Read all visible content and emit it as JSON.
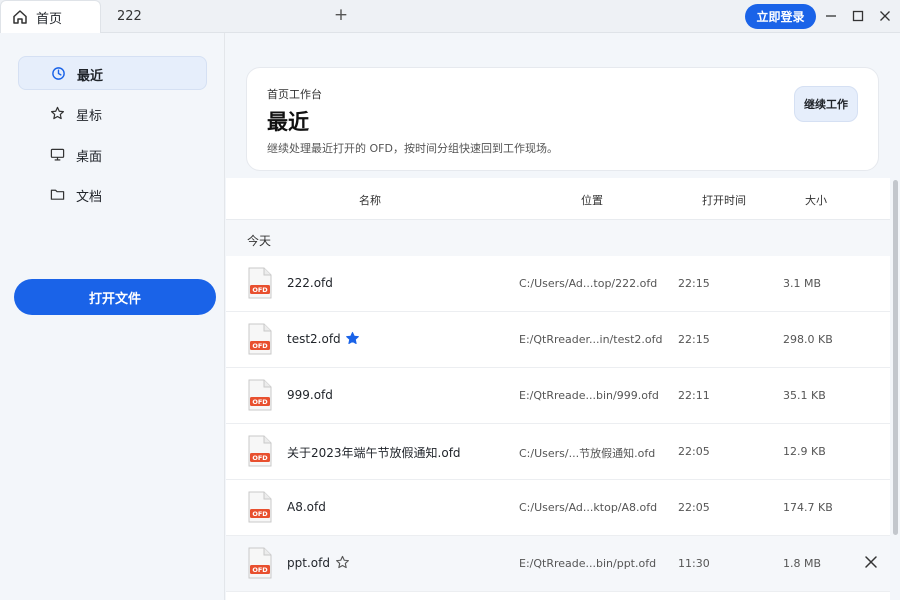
{
  "titlebar": {
    "tabs": [
      {
        "label": "首页",
        "icon": "home-icon",
        "active": true
      },
      {
        "label": "222",
        "active": false
      }
    ],
    "add_tab_label": "+",
    "login_label": "立即登录"
  },
  "sidebar": {
    "items": [
      {
        "label": "最近",
        "icon": "clock-icon",
        "active": true
      },
      {
        "label": "星标",
        "icon": "star-icon",
        "active": false
      },
      {
        "label": "桌面",
        "icon": "monitor-icon",
        "active": false
      },
      {
        "label": "文档",
        "icon": "folder-icon",
        "active": false
      }
    ],
    "open_file_label": "打开文件"
  },
  "hero": {
    "kicker": "首页工作台",
    "title": "最近",
    "description": "继续处理最近打开的 OFD，按时间分组快速回到工作现场。",
    "continue_label": "继续工作"
  },
  "table": {
    "columns": [
      "名称",
      "位置",
      "打开时间",
      "大小"
    ],
    "group_label": "今天",
    "rows": [
      {
        "name": "222.ofd",
        "location": "C:/Users/Ad...top/222.ofd",
        "time": "22:15",
        "size": "3.1 MB",
        "star": "none"
      },
      {
        "name": "test2.ofd",
        "location": "E:/QtRreader...in/test2.ofd",
        "time": "22:15",
        "size": "298.0 KB",
        "star": "filled"
      },
      {
        "name": "999.ofd",
        "location": "E:/QtRreade...bin/999.ofd",
        "time": "22:11",
        "size": "35.1 KB",
        "star": "none"
      },
      {
        "name": "关于2023年端午节放假通知.ofd",
        "location": "C:/Users/...节放假通知.ofd",
        "time": "22:05",
        "size": "12.9 KB",
        "star": "none"
      },
      {
        "name": "A8.ofd",
        "location": "C:/Users/Ad...ktop/A8.ofd",
        "time": "22:05",
        "size": "174.7 KB",
        "star": "none"
      },
      {
        "name": "ppt.ofd",
        "location": "E:/QtRreade...bin/ppt.ofd",
        "time": "11:30",
        "size": "1.8 MB",
        "star": "outline"
      }
    ],
    "file_badge": "OFD"
  },
  "colors": {
    "accent": "#1a63e8",
    "active_bg": "#e6eefb",
    "badge": "#e8502f"
  }
}
